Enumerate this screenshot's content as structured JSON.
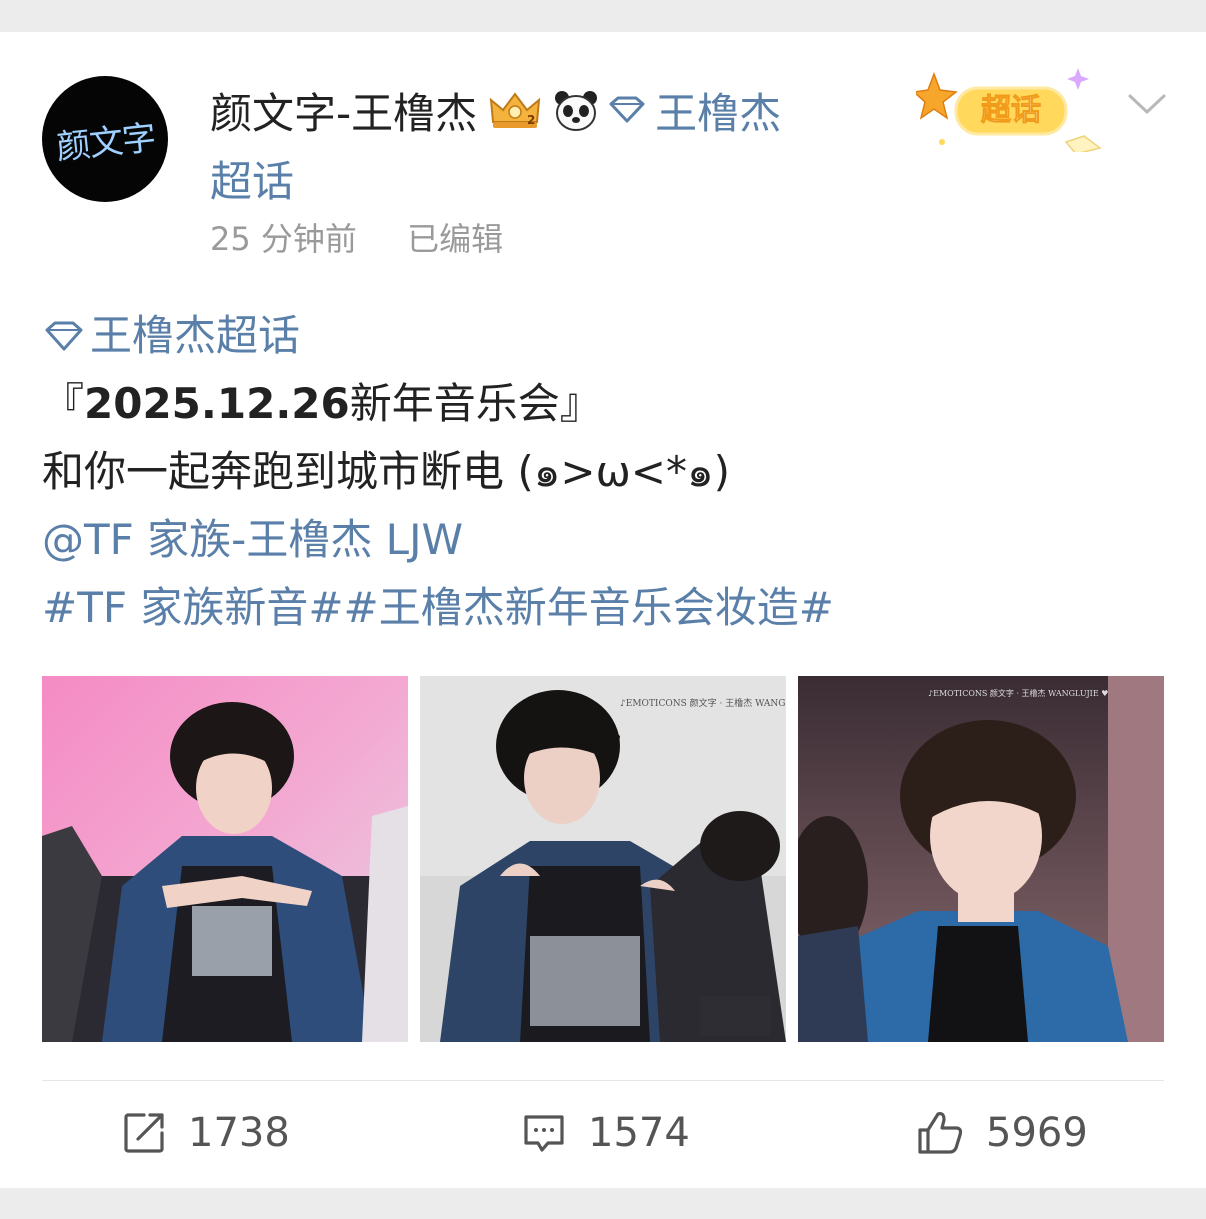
{
  "post": {
    "avatar_text": "颜文字",
    "user_name": "颜文字-王橹杰",
    "topic_link_part1": "王橹杰",
    "topic_link_part2": "超话",
    "timestamp": "25 分钟前",
    "edited": "已编辑",
    "chaohua_badge": "超话",
    "topic_tag": "王橹杰超话",
    "title_bracket_open": "『",
    "title_bold": "2025.12.26",
    "title_rest": "新年音乐会』",
    "text_line": "和你一起奔跑到城市断电 (๑>ω<*๑)",
    "mention": "@TF 家族-王橹杰 LJW",
    "hashtags": "#TF 家族新音##王橹杰新年音乐会妆造#"
  },
  "photos": [
    {
      "icon": "photo-performer-pink-stage"
    },
    {
      "icon": "photo-performer-grey-bg",
      "watermark": "♪EMOTICONS 颜文字 · 王橹杰 WANGLUJIE ♥"
    },
    {
      "icon": "photo-performer-portrait",
      "watermark": "♪EMOTICONS 颜文字 · 王橹杰 WANGLUJIE ♥"
    }
  ],
  "actions": {
    "repost_count": "1738",
    "comment_count": "1574",
    "like_count": "5969"
  },
  "colors": {
    "link": "#5a7fa8",
    "background": "#ececec",
    "card": "#ffffff"
  }
}
